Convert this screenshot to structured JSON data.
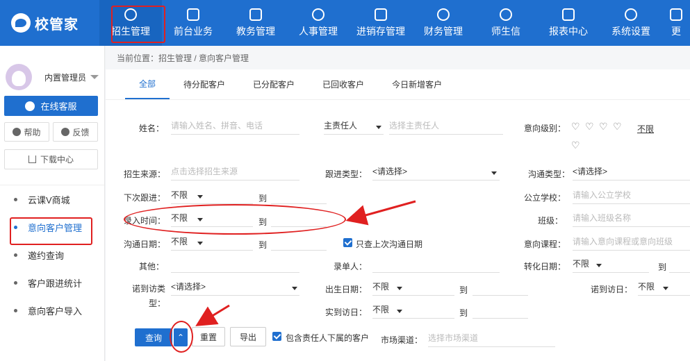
{
  "app": {
    "logo_text": "校管家"
  },
  "nav": {
    "items": [
      {
        "label": "招生管理",
        "icon": "user-add-icon"
      },
      {
        "label": "前台业务",
        "icon": "desk-icon"
      },
      {
        "label": "教务管理",
        "icon": "book-icon"
      },
      {
        "label": "人事管理",
        "icon": "person-icon"
      },
      {
        "label": "进销存管理",
        "icon": "inventory-icon"
      },
      {
        "label": "财务管理",
        "icon": "finance-icon"
      },
      {
        "label": "师生信",
        "icon": "message-icon"
      },
      {
        "label": "报表中心",
        "icon": "report-icon"
      },
      {
        "label": "系统设置",
        "icon": "gear-icon"
      },
      {
        "label": "更",
        "icon": "more-icon"
      }
    ]
  },
  "sidebar": {
    "username": "内置管理员",
    "online_service": "在线客服",
    "help": "帮助",
    "feedback": "反馈",
    "download": "下载中心",
    "menu": [
      {
        "label": "云课V商城"
      },
      {
        "label": "意向客户管理"
      },
      {
        "label": "邀约查询"
      },
      {
        "label": "客户跟进统计"
      },
      {
        "label": "意向客户导入"
      }
    ]
  },
  "breadcrumb": "当前位置：招生管理 / 意向客户管理",
  "tabs": [
    "全部",
    "待分配客户",
    "已分配客户",
    "已回收客户",
    "今日新增客户"
  ],
  "form": {
    "name_label": "姓名：",
    "name_placeholder": "请输入姓名、拼音、电话",
    "owner_select": "主责任人",
    "owner_placeholder": "选择主责任人",
    "level_label": "意向级别：",
    "level_unlimited": "不限",
    "source_label": "招生来源：",
    "source_placeholder": "点击选择招生来源",
    "follow_type_label": "跟进类型：",
    "follow_type_value": "<请选择>",
    "comm_type_label": "沟通类型：",
    "comm_type_value": "<请选择>",
    "next_follow_label": "下次跟进：",
    "next_follow_value": "不限",
    "to": "到",
    "school_label": "公立学校：",
    "school_placeholder": "请输入公立学校",
    "entry_time_label": "录入时间：",
    "entry_time_value": "不限",
    "class_label": "班级：",
    "class_placeholder": "请输入班级名称",
    "comm_date_label": "沟通日期：",
    "comm_date_value": "不限",
    "last_comm_only": "只查上次沟通日期",
    "course_label": "意向课程：",
    "course_placeholder": "请输入意向课程或意向班级",
    "other_label": "其他：",
    "recorder_label": "录单人：",
    "convert_date_label": "转化日期：",
    "convert_date_value": "不限",
    "visit_type_label": "诺到访类",
    "visit_type_label2": "型：",
    "visit_type_value": "<请选择>",
    "birth_label": "出生日期：",
    "birth_value": "不限",
    "promise_visit_label": "诺到访日：",
    "promise_visit_value": "不限",
    "actual_visit_label": "实到访日：",
    "actual_visit_value": "不限",
    "query_btn": "查询",
    "reset_btn": "重置",
    "export_btn": "导出",
    "include_sub": "包含责任人下属的客户",
    "channel_label": "市场渠道：",
    "channel_placeholder": "选择市场渠道"
  }
}
